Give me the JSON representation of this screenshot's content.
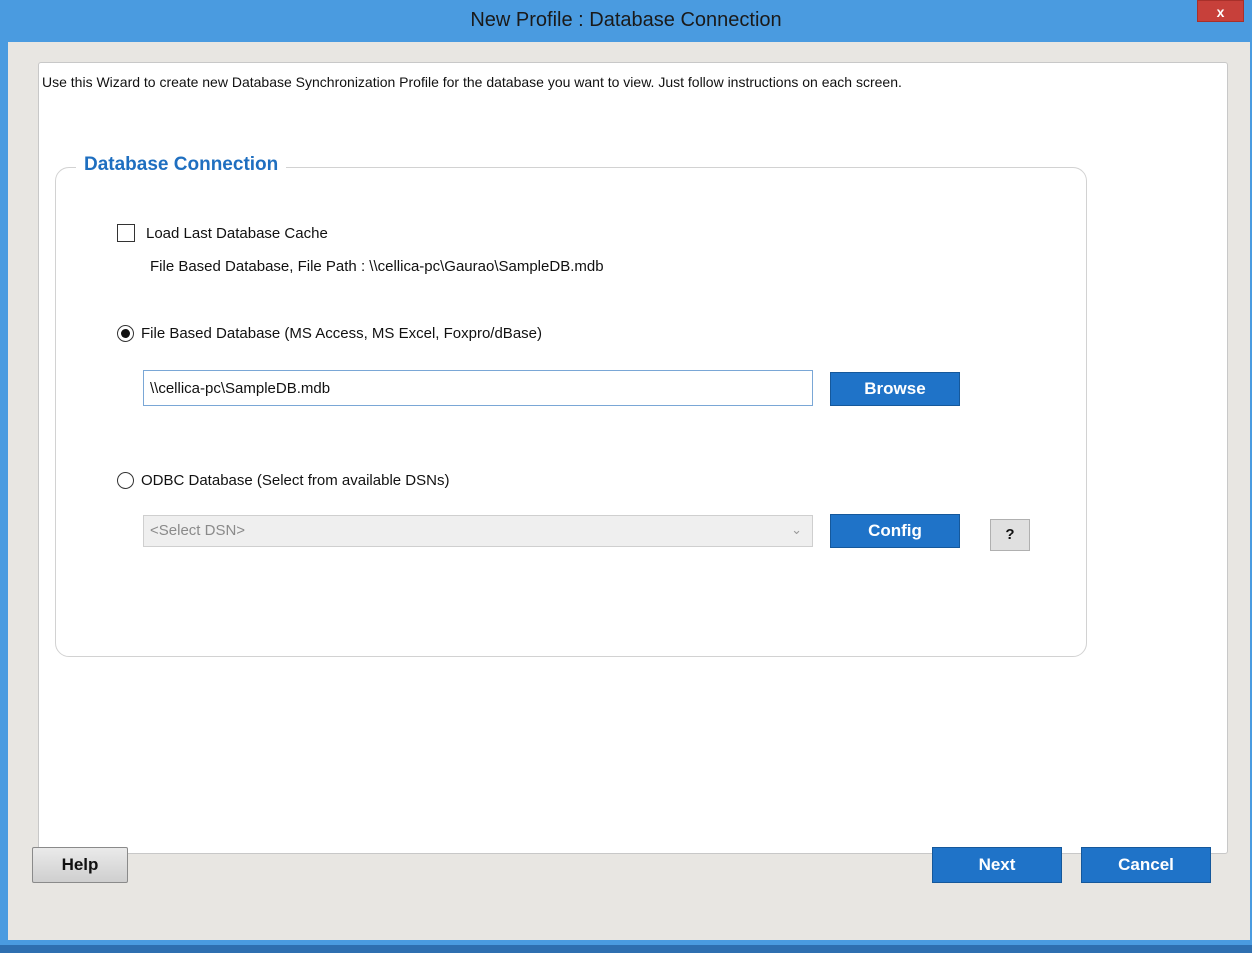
{
  "window": {
    "title": "New Profile : Database Connection",
    "close_glyph": "x"
  },
  "intro_text": "Use this Wizard to create new Database Synchronization Profile for the database you want to view. Just follow instructions on each screen.",
  "group": {
    "legend": "Database Connection",
    "load_cache": {
      "label": "Load Last Database Cache",
      "checked": false
    },
    "cache_path": "File Based Database, File Path : \\\\cellica-pc\\Gaurao\\SampleDB.mdb",
    "file_based": {
      "label": "File Based Database (MS Access, MS Excel, Foxpro/dBase)",
      "selected": true,
      "path_value": "\\\\cellica-pc\\SampleDB.mdb",
      "browse_label": "Browse"
    },
    "odbc": {
      "label": "ODBC Database (Select from available DSNs)",
      "selected": false,
      "dsn_value": "<Select DSN>",
      "config_label": "Config",
      "help_label": "?"
    }
  },
  "footer": {
    "help_label": "Help",
    "next_label": "Next",
    "cancel_label": "Cancel"
  },
  "colors": {
    "accent": "#1f73c8",
    "legend": "#1f6fc0",
    "titlebar": "#4a9be0",
    "close": "#c7403a"
  }
}
